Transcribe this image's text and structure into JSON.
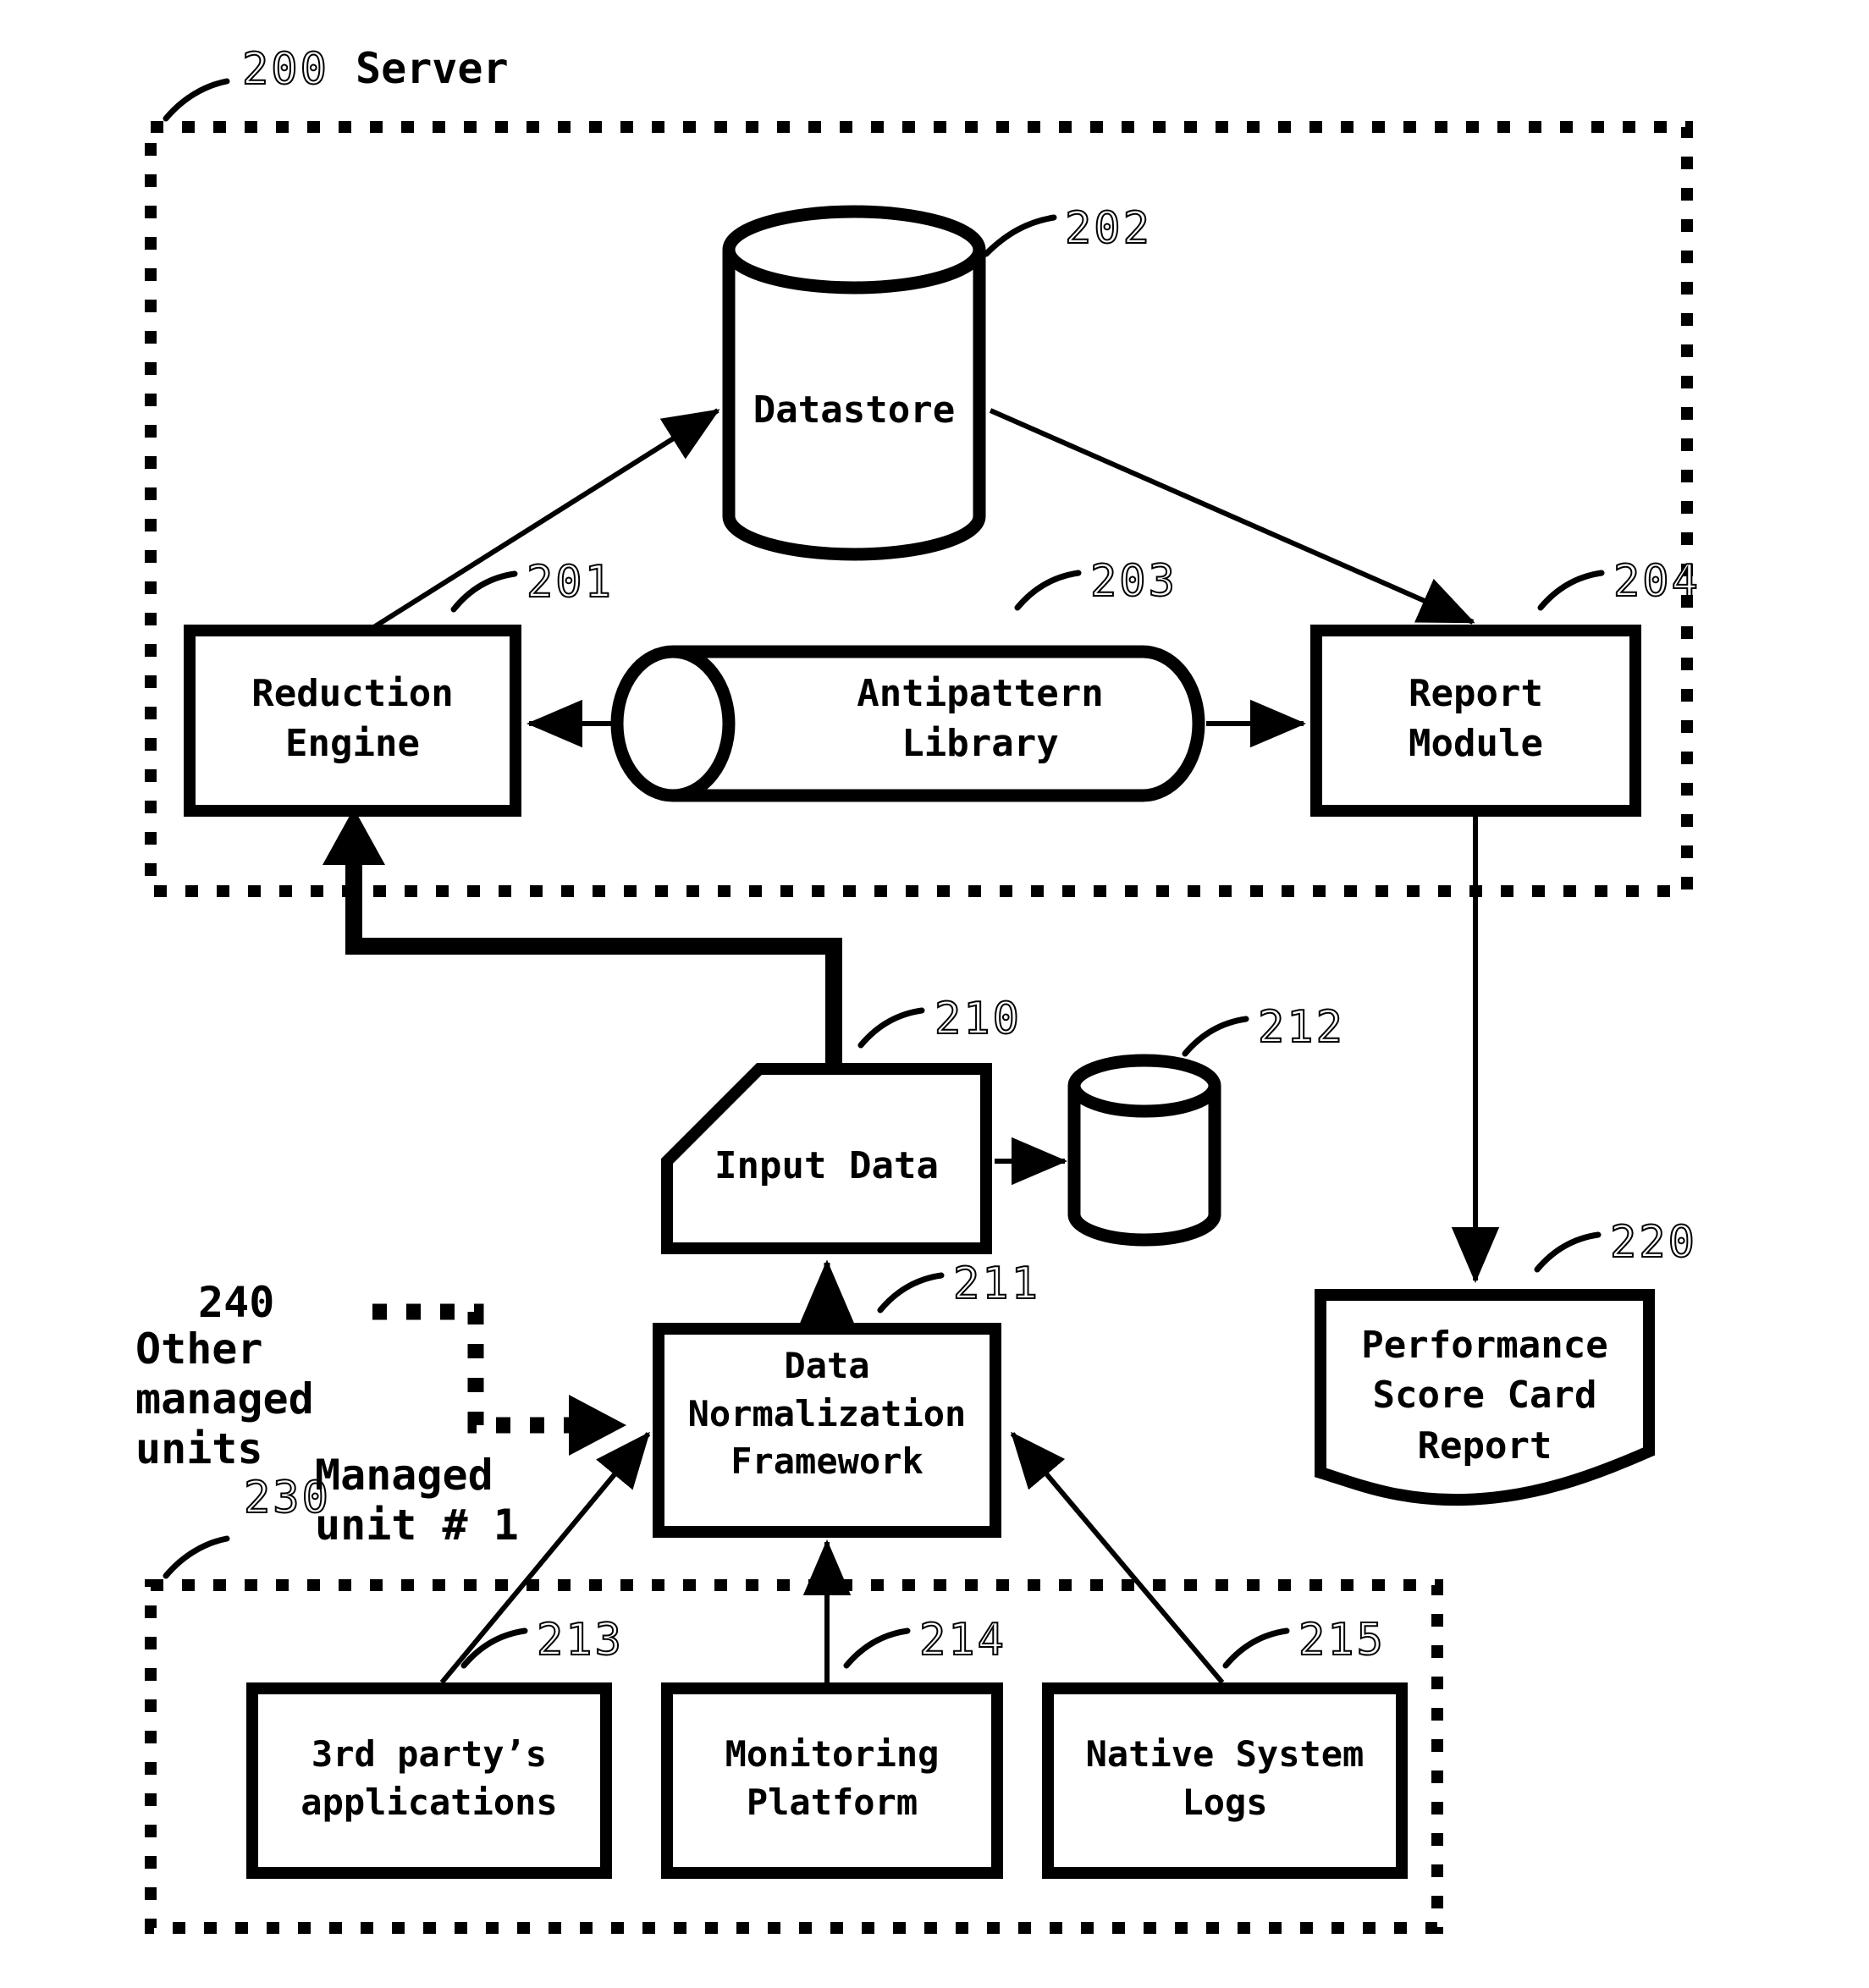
{
  "figure": {
    "type": "patent-block-diagram",
    "background": "#ffffff",
    "stroke_color": "#000000"
  },
  "containers": [
    {
      "id": "server",
      "ref": "200",
      "label": "Server",
      "border": "dotted"
    },
    {
      "id": "managed-unit-1",
      "ref": "230",
      "label": "Managed\nunit # 1",
      "border": "dotted"
    },
    {
      "id": "other-managed-units",
      "ref": "240",
      "label": "Other\nmanaged\nunits",
      "border": "dotted"
    }
  ],
  "nodes": [
    {
      "id": "datastore",
      "ref": "202",
      "label": "Datastore",
      "shape": "cylinder-vertical"
    },
    {
      "id": "reduction-engine",
      "ref": "201",
      "label": "Reduction\nEngine",
      "shape": "rectangle"
    },
    {
      "id": "antipattern-library",
      "ref": "203",
      "label": "Antipattern\nLibrary",
      "shape": "cylinder-horizontal"
    },
    {
      "id": "report-module",
      "ref": "204",
      "label": "Report\nModule",
      "shape": "rectangle"
    },
    {
      "id": "input-data",
      "ref": "210",
      "label": "Input Data",
      "shape": "note-cut-corner"
    },
    {
      "id": "local-store",
      "ref": "212",
      "label": "",
      "shape": "cylinder-vertical"
    },
    {
      "id": "data-normalization",
      "ref": "211",
      "label": "Data\nNormalization\nFramework",
      "shape": "rectangle"
    },
    {
      "id": "performance-report",
      "ref": "220",
      "label": "Performance\nScore Card\nReport",
      "shape": "document-wave"
    },
    {
      "id": "third-party-apps",
      "ref": "213",
      "label": "3rd party’s\napplications",
      "shape": "rectangle"
    },
    {
      "id": "monitoring-platform",
      "ref": "214",
      "label": "Monitoring\nPlatform",
      "shape": "rectangle"
    },
    {
      "id": "native-system-logs",
      "ref": "215",
      "label": "Native System\nLogs",
      "shape": "rectangle"
    }
  ],
  "ref_numerals": [
    "200",
    "201",
    "202",
    "203",
    "204",
    "210",
    "211",
    "212",
    "213",
    "214",
    "215",
    "220",
    "230",
    "240"
  ],
  "edges": [
    {
      "from": "reduction-engine",
      "to": "datastore",
      "style": "solid-thin",
      "arrow": "end"
    },
    {
      "from": "datastore",
      "to": "report-module",
      "style": "solid-thin",
      "arrow": "end"
    },
    {
      "from": "antipattern-library",
      "to": "reduction-engine",
      "style": "solid-thin",
      "arrow": "end"
    },
    {
      "from": "antipattern-library",
      "to": "report-module",
      "style": "solid-thin",
      "arrow": "end"
    },
    {
      "from": "report-module",
      "to": "performance-report",
      "style": "solid-thin",
      "arrow": "end"
    },
    {
      "from": "input-data",
      "to": "reduction-engine",
      "style": "solid-thick",
      "arrow": "end"
    },
    {
      "from": "input-data",
      "to": "local-store",
      "style": "solid-thin",
      "arrow": "end"
    },
    {
      "from": "data-normalization",
      "to": "input-data",
      "style": "solid-thin",
      "arrow": "end"
    },
    {
      "from": "other-managed-units",
      "to": "data-normalization",
      "style": "dotted-thick",
      "arrow": "end"
    },
    {
      "from": "third-party-apps",
      "to": "data-normalization",
      "style": "solid-thin",
      "arrow": "end"
    },
    {
      "from": "monitoring-platform",
      "to": "data-normalization",
      "style": "solid-thin",
      "arrow": "end"
    },
    {
      "from": "native-system-logs",
      "to": "data-normalization",
      "style": "solid-thin",
      "arrow": "end"
    }
  ]
}
